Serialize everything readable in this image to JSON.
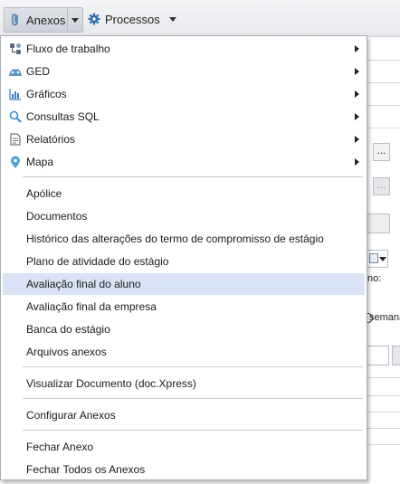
{
  "toolbar": {
    "anexos_label": "Anexos",
    "processos_label": "Processos",
    "anexos_icon": "paperclip-icon",
    "processos_icon": "gear-icon"
  },
  "background": {
    "ellipsis": "...",
    "frag_no": "no:",
    "frag_semana": "semana"
  },
  "menu": {
    "submenus": [
      {
        "label": "Fluxo de trabalho",
        "icon": "workflow-icon"
      },
      {
        "label": "GED",
        "icon": "ged-icon"
      },
      {
        "label": "Gráficos",
        "icon": "chart-icon"
      },
      {
        "label": "Consultas SQL",
        "icon": "search-icon"
      },
      {
        "label": "Relatórios",
        "icon": "report-icon"
      },
      {
        "label": "Mapa",
        "icon": "map-pin-icon"
      }
    ],
    "items": [
      {
        "label": "Apólice"
      },
      {
        "label": "Documentos"
      },
      {
        "label": "Histórico das alterações do termo de compromisso de estágio"
      },
      {
        "label": "Plano de atividade do estágio"
      },
      {
        "label": "Avaliação final do aluno",
        "highlighted": true
      },
      {
        "label": "Avaliação final da empresa"
      },
      {
        "label": "Banca do estágio"
      },
      {
        "label": "Arquivos anexos"
      }
    ],
    "visualizar": "Visualizar Documento (doc.Xpress)",
    "configurar": "Configurar Anexos",
    "fechar": "Fechar Anexo",
    "fechar_todos": "Fechar Todos os Anexos",
    "highlight_color": "#d9e3f5"
  }
}
